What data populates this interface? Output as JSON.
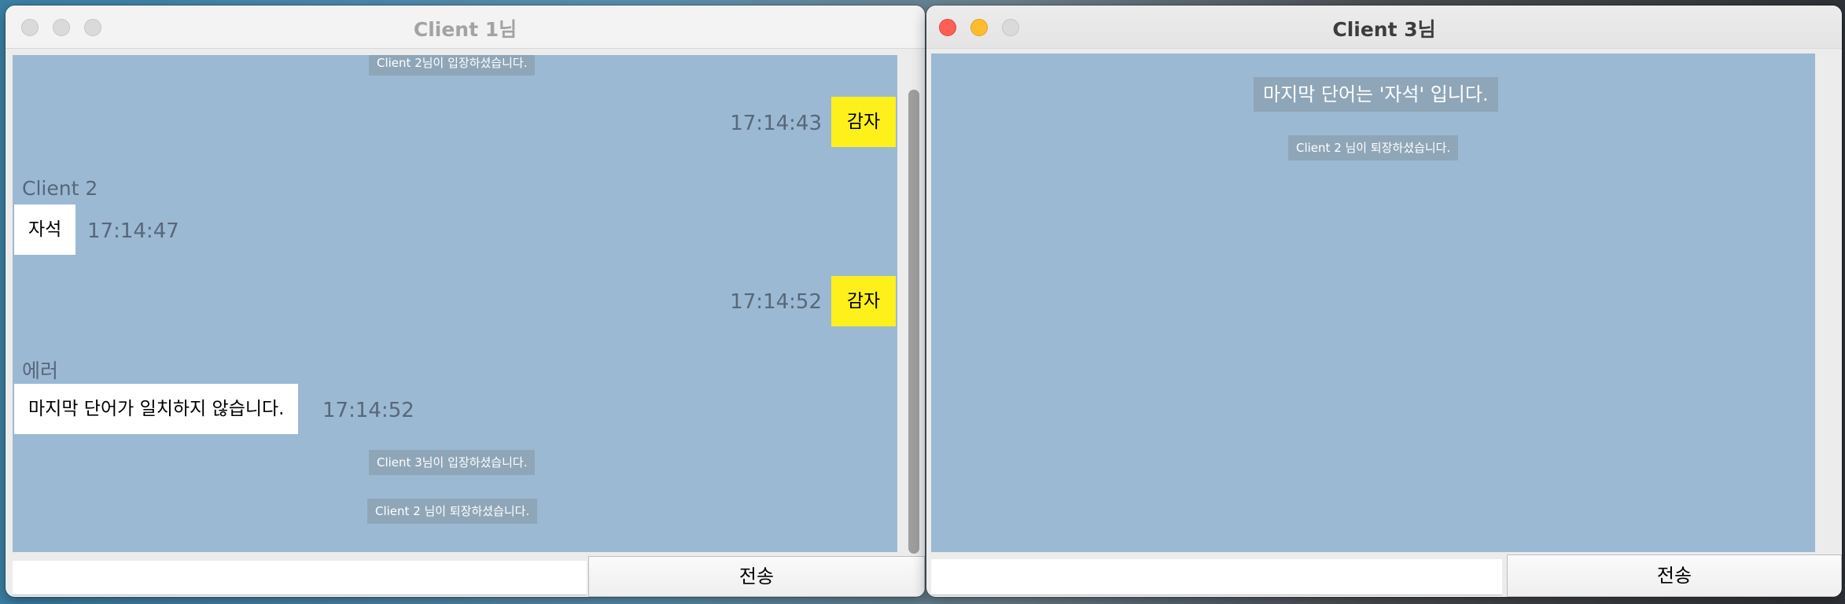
{
  "windows": [
    {
      "title": "Client 1님",
      "active": false,
      "messages": {
        "notice_top": "Client 2님이 입장하셨습니다.",
        "mine_1": {
          "text": "감자",
          "time": "17:14:43"
        },
        "other_1": {
          "sender": "Client 2",
          "text": "자석",
          "time": "17:14:47"
        },
        "mine_2": {
          "text": "감자",
          "time": "17:14:52"
        },
        "other_2": {
          "sender": "에러",
          "text": "마지막 단어가 일치하지 않습니다.",
          "time": "17:14:52"
        },
        "notice_join": "Client 3님이 입장하셨습니다.",
        "notice_leave": "Client 2 님이 퇴장하셨습니다."
      },
      "send_label": "전송",
      "input_value": ""
    },
    {
      "title": "Client 3님",
      "active": true,
      "messages": {
        "notice_last_word": "마지막 단어는 '자석' 입니다.",
        "notice_leave": "Client 2 님이 퇴장하셨습니다."
      },
      "send_label": "전송",
      "input_value": ""
    }
  ],
  "colors": {
    "chat_bg": "#9bb9d3",
    "my_bubble": "#fef01b",
    "other_bubble": "#ffffff",
    "notice_bg": "#8fa6b8",
    "close": "#fe5f57",
    "minimize": "#febc2e"
  },
  "icons": [
    "close-button-icon",
    "minimize-button-icon",
    "zoom-button-icon"
  ]
}
